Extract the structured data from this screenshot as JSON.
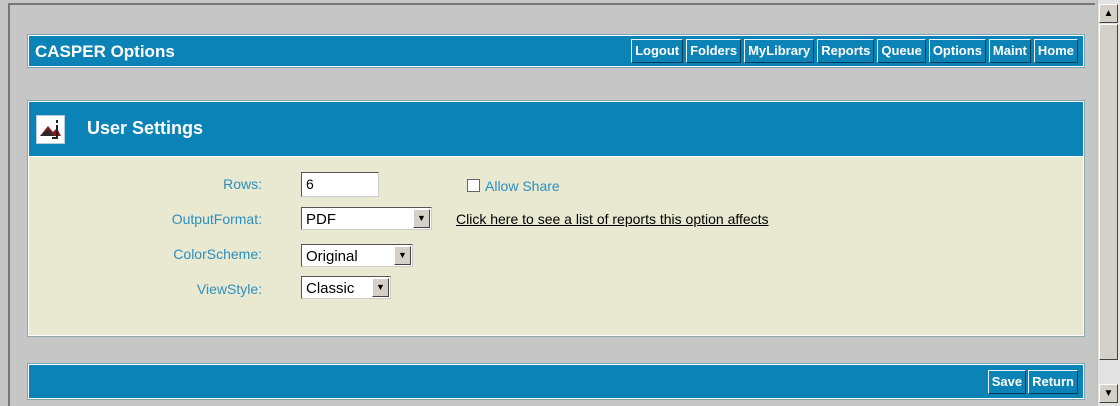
{
  "header": {
    "title": "CASPER Options",
    "nav": [
      "Logout",
      "Folders",
      "MyLibrary",
      "Reports",
      "Queue",
      "Options",
      "Maint",
      "Home"
    ]
  },
  "panel": {
    "title": "User Settings",
    "logo_icon": "casper-logo-icon"
  },
  "form": {
    "rows_label": "Rows:",
    "rows_value": "6",
    "allow_share_label": "Allow Share",
    "allow_share_checked": false,
    "output_format_label": "OutputFormat:",
    "output_format_value": "PDF",
    "options_link": "Click here to see a list of reports this option affects",
    "color_scheme_label": "ColorScheme:",
    "color_scheme_value": "Original",
    "view_style_label": "ViewStyle:",
    "view_style_value": "Classic"
  },
  "footer": {
    "save_label": "Save",
    "return_label": "Return"
  },
  "colors": {
    "bar": "#0c83b6",
    "panel_bg": "#e9e8d1",
    "label": "#2b8fc0"
  }
}
